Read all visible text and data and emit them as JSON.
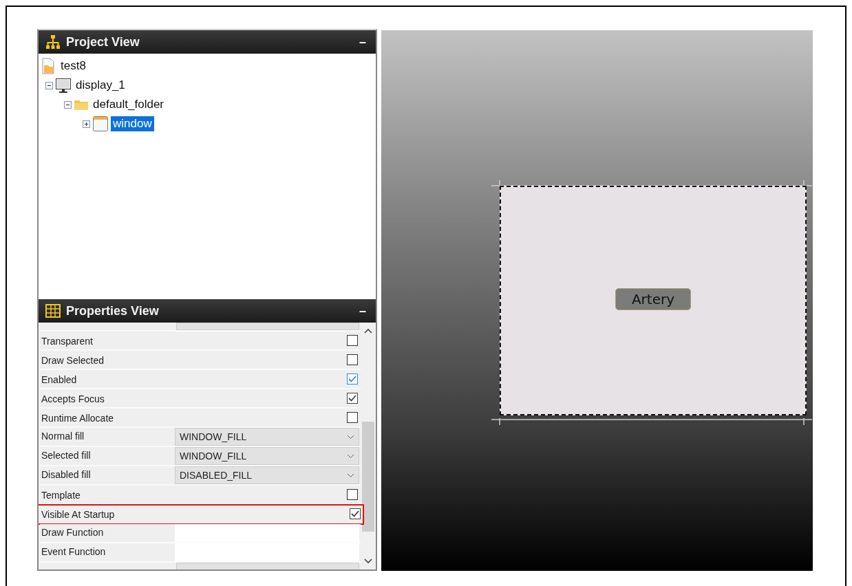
{
  "project_view": {
    "title": "Project View",
    "minimize": "–",
    "tree": [
      {
        "label": "test8",
        "kind": "project",
        "selected": false,
        "children": [
          {
            "label": "display_1",
            "kind": "display",
            "expanded": true,
            "selected": false,
            "children": [
              {
                "label": "default_folder",
                "kind": "folder",
                "expanded": true,
                "selected": false,
                "children": [
                  {
                    "label": "window",
                    "kind": "window",
                    "expanded": false,
                    "selected": true
                  }
                ]
              }
            ]
          }
        ]
      }
    ]
  },
  "properties_view": {
    "title": "Properties View",
    "minimize": "–",
    "rows": [
      {
        "kind": "cut"
      },
      {
        "kind": "checkbox",
        "label": "Transparent",
        "checked": false,
        "highlighted": false
      },
      {
        "kind": "checkbox",
        "label": "Draw Selected",
        "checked": false,
        "highlighted": false
      },
      {
        "kind": "checkbox",
        "label": "Enabled",
        "checked": true,
        "color": "#2a8ae0",
        "highlighted": false
      },
      {
        "kind": "checkbox",
        "label": "Accepts Focus",
        "checked": true,
        "color": "#444444",
        "highlighted": false
      },
      {
        "kind": "checkbox",
        "label": "Runtime Allocate",
        "checked": false,
        "highlighted": false
      },
      {
        "kind": "dropdown",
        "label": "Normal fill",
        "value": "WINDOW_FILL"
      },
      {
        "kind": "dropdown",
        "label": "Selected fill",
        "value": "WINDOW_FILL"
      },
      {
        "kind": "dropdown",
        "label": "Disabled fill",
        "value": "DISABLED_FILL"
      },
      {
        "kind": "checkbox",
        "label": "Template",
        "checked": false,
        "highlighted": false
      },
      {
        "kind": "checkbox",
        "label": "Visible At Startup",
        "checked": true,
        "color": "#444444",
        "highlighted": true
      },
      {
        "kind": "text",
        "label": "Draw Function"
      },
      {
        "kind": "text",
        "label": "Event Function"
      },
      {
        "kind": "cut"
      }
    ]
  },
  "canvas": {
    "button_label": "Artery"
  }
}
